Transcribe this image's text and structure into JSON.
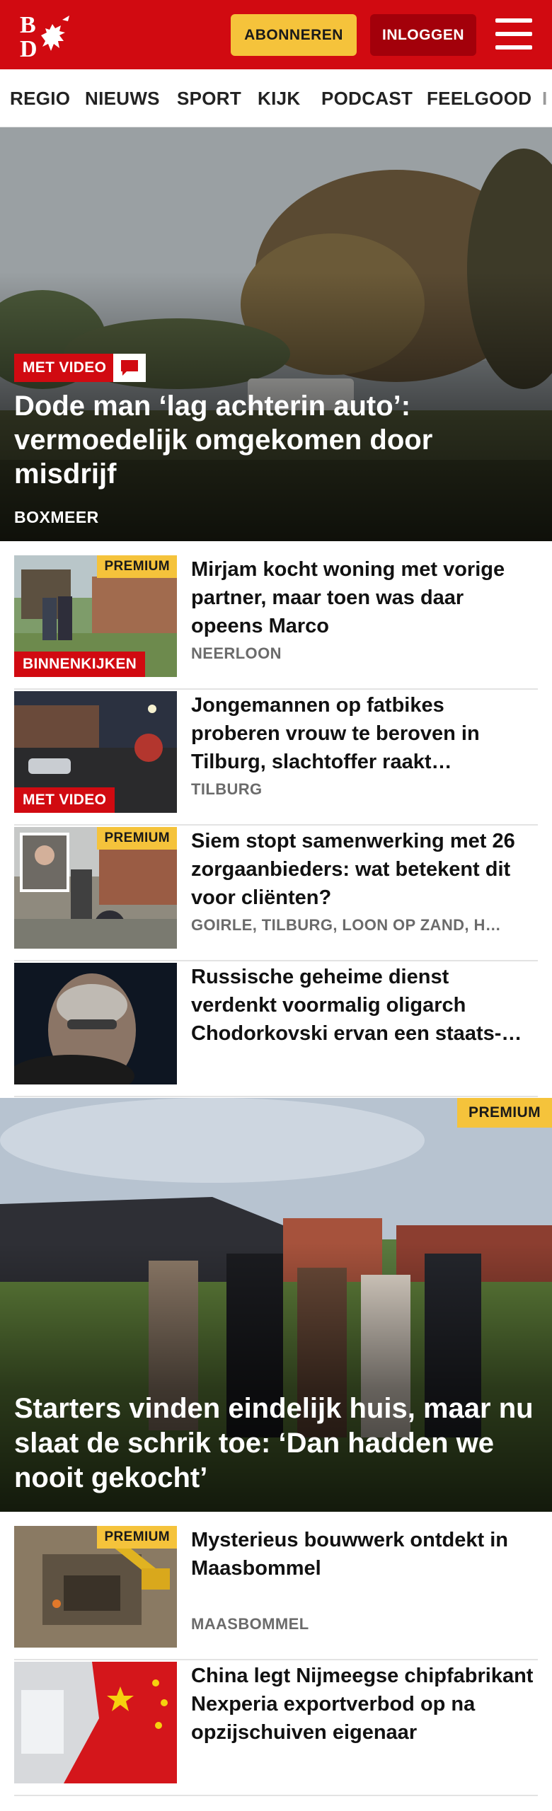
{
  "header": {
    "logo_text": "BD",
    "subscribe_label": "ABONNEREN",
    "login_label": "INLOGGEN",
    "menu_icon": "hamburger-menu-icon"
  },
  "nav": {
    "items": [
      {
        "label": "REGIO"
      },
      {
        "label": "NIEUWS"
      },
      {
        "label": "SPORT"
      },
      {
        "label": "KIJK"
      },
      {
        "label": "PODCAST"
      },
      {
        "label": "FEELGOOD"
      },
      {
        "label": "I"
      }
    ]
  },
  "hero": {
    "badge": "MET VIDEO",
    "comment_icon": "comment-icon",
    "title": "Dode man ‘lag achterin auto’: vermoedelijk omgekomen door misdrijf",
    "location": "BOXMEER"
  },
  "articles": [
    {
      "title": "Mirjam kocht woning met vorige partner, maar toen was daar opeens Marco",
      "location": "NEERLOON",
      "premium": "PREMIUM",
      "label": "BINNENKIJKEN"
    },
    {
      "title": "Jongemannen op fatbikes proberen vrouw te beroven in Tilburg, slachtoffer raakt…",
      "location": "TILBURG",
      "premium": "",
      "label": "MET VIDEO"
    },
    {
      "title": "Siem stopt samenwerking met 26 zorgaanbieders: wat betekent dit voor cliënten?",
      "location": "GOIRLE, TILBURG, LOON OP ZAND, H…",
      "premium": "PREMIUM",
      "label": ""
    },
    {
      "title": "Russische geheime dienst verdenkt voormalig oligarch Chodorkovski ervan een staats-…",
      "location": "",
      "premium": "",
      "label": ""
    }
  ],
  "feature": {
    "premium": "PREMIUM",
    "title": "Starters vinden eindelijk huis, maar nu slaat de schrik toe: ‘Dan hadden we nooit gekocht’"
  },
  "articles2": [
    {
      "title": "Mysterieus bouwwerk ontdekt in Maasbommel",
      "location": "MAASBOMMEL",
      "premium": "PREMIUM"
    },
    {
      "title": "China legt Nijmeegse chipfabri­kant Nexperia exportverbod op na opzijschuiven eigenaar",
      "location": "",
      "premium": ""
    }
  ],
  "colors": {
    "brand_red": "#d10a11",
    "premium_yellow": "#f5c33b",
    "login_dark_red": "#a3000a"
  }
}
